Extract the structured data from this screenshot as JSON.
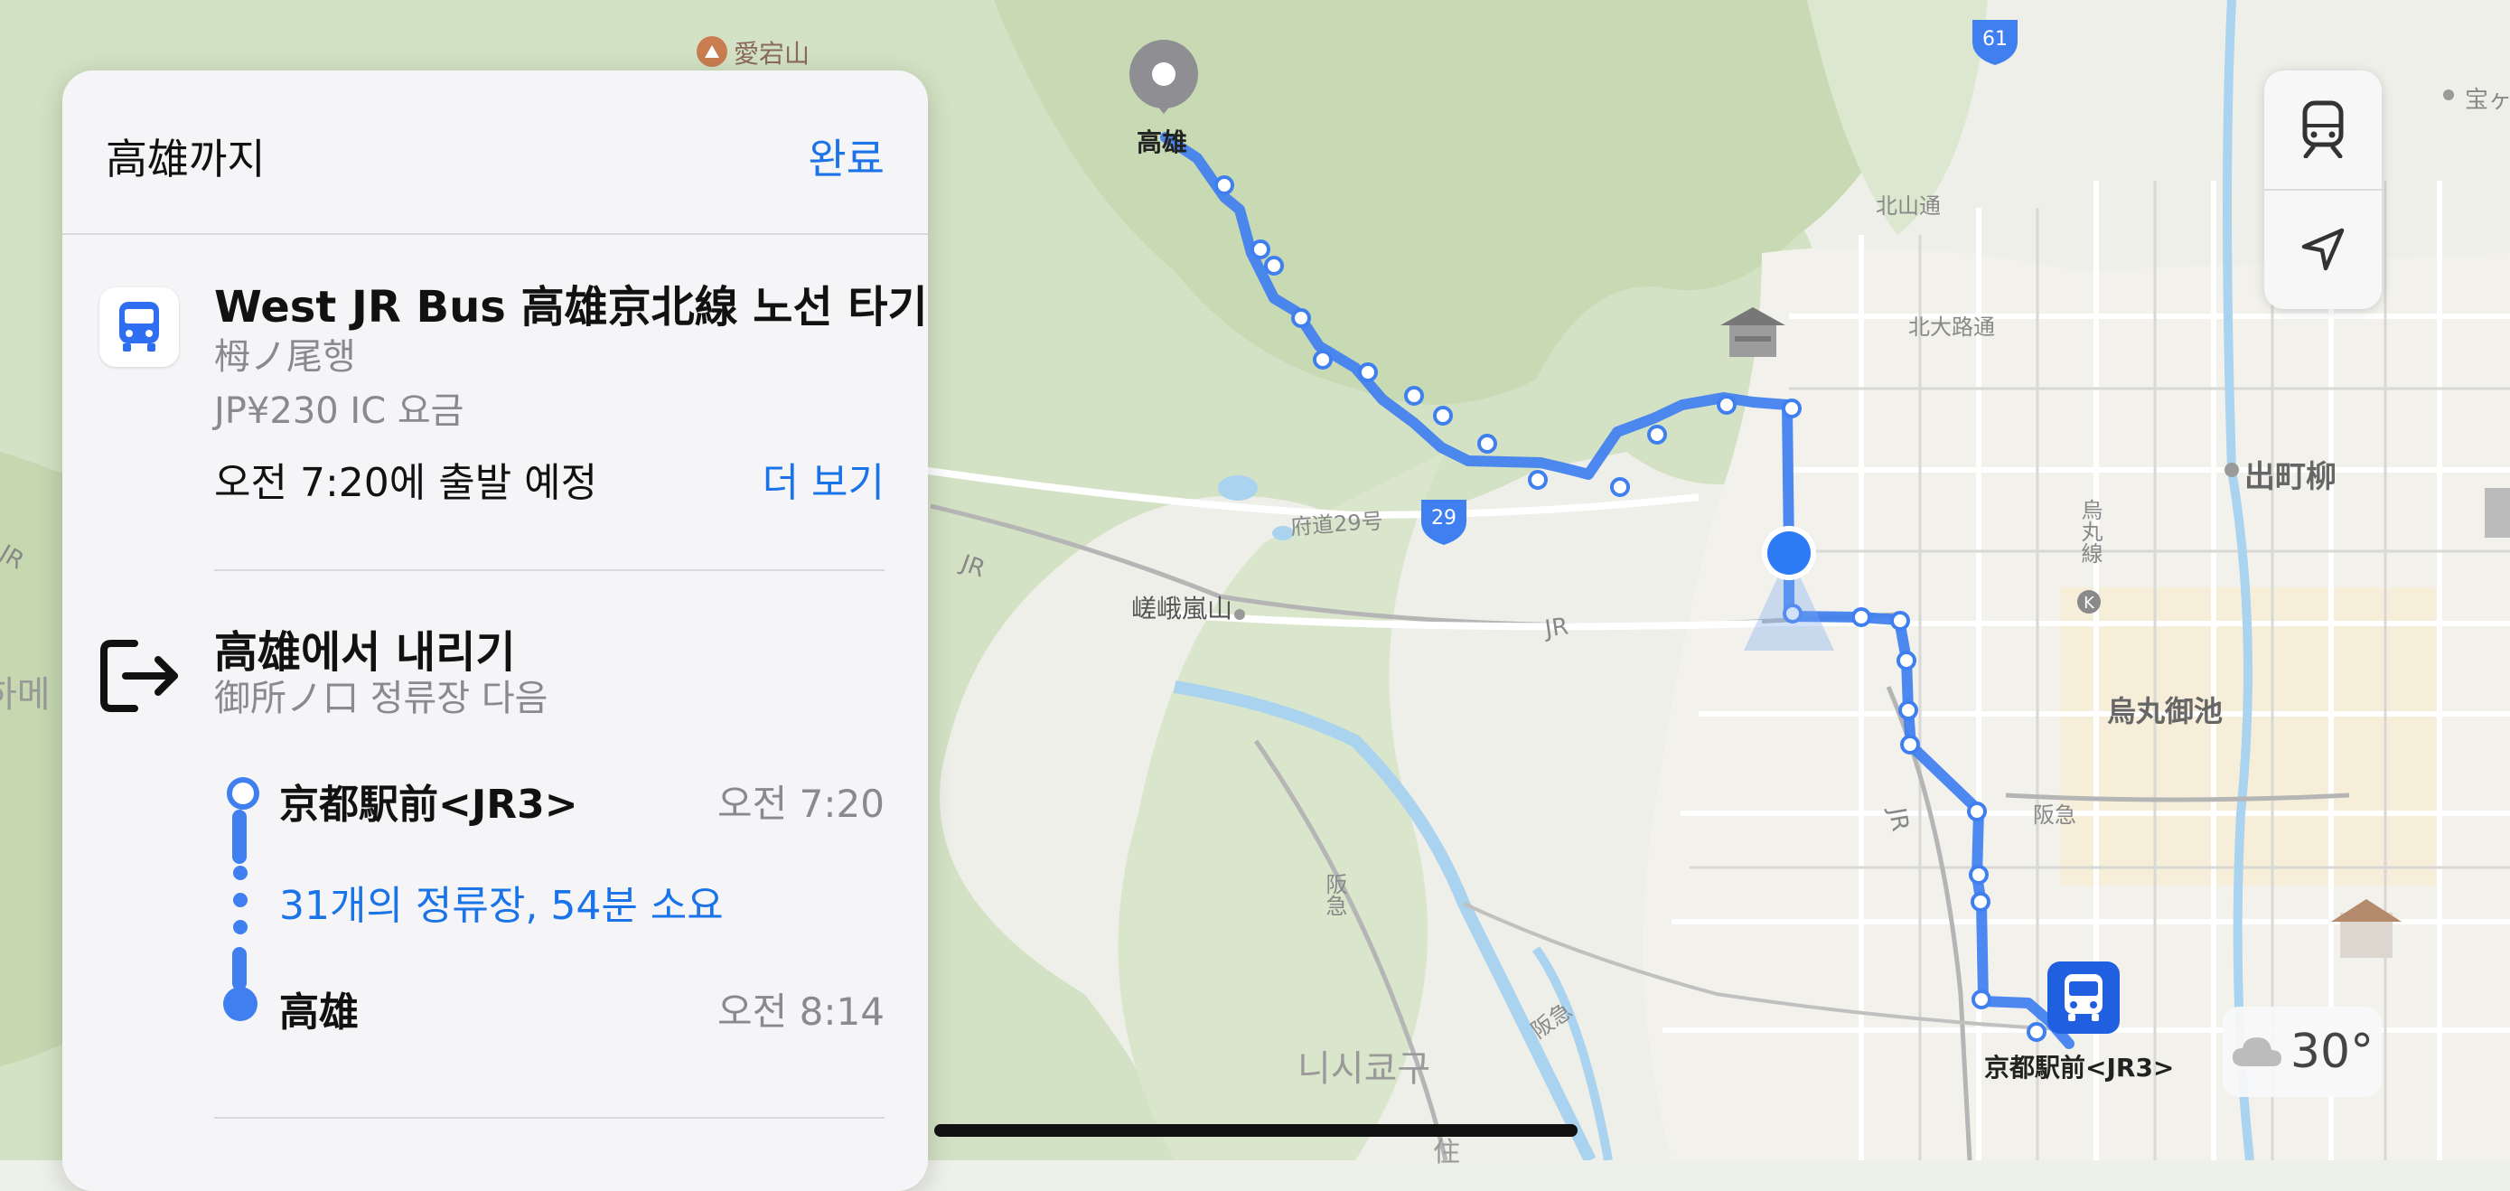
{
  "panel": {
    "title": "高雄까지",
    "done": "완료",
    "board": {
      "title": "West JR Bus 高雄京北線 노선 타기",
      "direction": "栂ノ尾행",
      "fare": "JP¥230 IC 요금",
      "departure": "오전 7:20에 출발 예정",
      "more": "더 보기"
    },
    "alight": {
      "title": "高雄에서 내리기",
      "subtitle": "御所ノ口 정류장 다음"
    },
    "timeline": {
      "start_stop": "京都駅前<JR3>",
      "start_time": "오전 7:20",
      "stops_info": "31개의 정류장, 54분 소요",
      "end_stop": "高雄",
      "end_time": "오전 8:14"
    }
  },
  "map": {
    "labels": {
      "atago": "愛宕山",
      "takao": "高雄",
      "kitayama": "北山通",
      "kitaoji": "北大路通",
      "demachi": "出町柳",
      "karasuma_line": "烏丸線",
      "karasuma_oike": "烏丸御池",
      "sagaarashiyama": "嵯峨嵐山",
      "jr1": "JR",
      "jr2": "JR",
      "jr3": "JR",
      "jr4": "JR",
      "hankyu1": "阪急",
      "hankyu2": "阪急",
      "hankyu3": "阪急",
      "pref29": "府道29号",
      "route29": "29",
      "route61": "61",
      "nishikyo": "니시쿄구",
      "origin": "京都駅前<JR3>",
      "takara": "宝ヶ",
      "cutoff_left": "하메",
      "k_marker": "K",
      "bottom_cut": "住"
    },
    "colors": {
      "route": "#3f7ff0",
      "water": "#a9d3ef",
      "forest": "#c6d9b4"
    }
  },
  "controls": {
    "transit_icon": "train-icon",
    "location_icon": "location-arrow-icon"
  },
  "weather": {
    "icon": "cloud-icon",
    "temp": "30°"
  }
}
